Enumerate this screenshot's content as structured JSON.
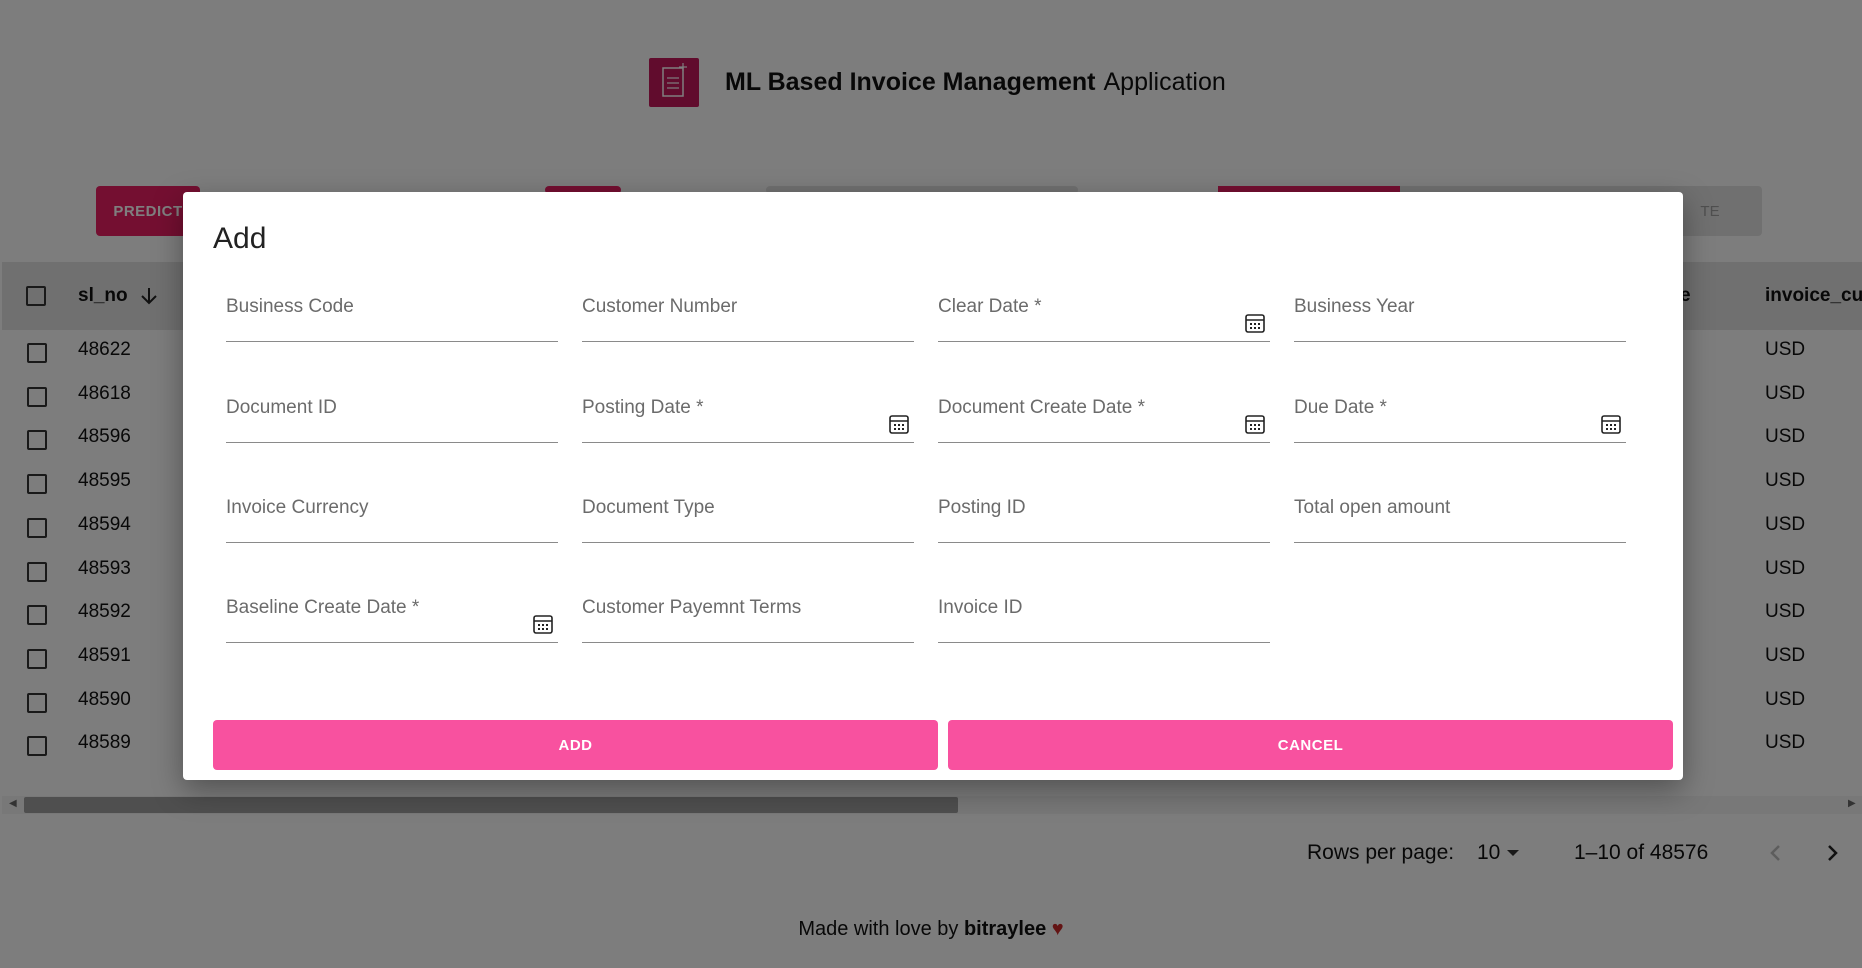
{
  "app": {
    "title_bold": "ML Based Invoice Management",
    "title_light": "Application",
    "logo_icon": "document-icon"
  },
  "toolbar": {
    "predict_label": "PREDICT",
    "faded_label": "TE"
  },
  "table": {
    "headers": {
      "sl_no": "sl_no",
      "partial_right": "e",
      "invoice_currency": "invoice_cu"
    },
    "sort_icon": "arrow-down-icon",
    "rows": [
      {
        "sl_no": "48622",
        "currency": "USD"
      },
      {
        "sl_no": "48618",
        "currency": "USD"
      },
      {
        "sl_no": "48596",
        "currency": "USD"
      },
      {
        "sl_no": "48595",
        "currency": "USD"
      },
      {
        "sl_no": "48594",
        "currency": "USD"
      },
      {
        "sl_no": "48593",
        "currency": "USD"
      },
      {
        "sl_no": "48592",
        "currency": "USD"
      },
      {
        "sl_no": "48591",
        "currency": "USD"
      },
      {
        "sl_no": "48590",
        "currency": "USD"
      },
      {
        "sl_no": "48589",
        "currency": "USD"
      }
    ]
  },
  "pagination": {
    "rows_per_page_label": "Rows per page:",
    "rows_per_page_value": "10",
    "range": "1–10 of 48576"
  },
  "footer": {
    "prefix": "Made with love by",
    "author": "bitraylee",
    "heart": "♥"
  },
  "modal": {
    "title": "Add",
    "fields": [
      {
        "label": "Business Code",
        "calendar": false
      },
      {
        "label": "Customer Number",
        "calendar": false
      },
      {
        "label": "Clear Date *",
        "calendar": true
      },
      {
        "label": "Business Year",
        "calendar": false
      },
      {
        "label": "Document ID",
        "calendar": false
      },
      {
        "label": "Posting Date *",
        "calendar": true
      },
      {
        "label": "Document Create Date *",
        "calendar": true
      },
      {
        "label": "Due Date *",
        "calendar": true
      },
      {
        "label": "Invoice Currency",
        "calendar": false
      },
      {
        "label": "Document Type",
        "calendar": false
      },
      {
        "label": "Posting ID",
        "calendar": false
      },
      {
        "label": "Total open amount",
        "calendar": false
      },
      {
        "label": "Baseline Create Date *",
        "calendar": true
      },
      {
        "label": "Customer Payemnt Terms",
        "calendar": false
      },
      {
        "label": "Invoice ID",
        "calendar": false
      }
    ],
    "add_label": "ADD",
    "cancel_label": "CANCEL"
  },
  "colors": {
    "brand": "#c2185b",
    "accent": "#f8519f",
    "overlay": "rgba(0,0,0,0.5)"
  }
}
